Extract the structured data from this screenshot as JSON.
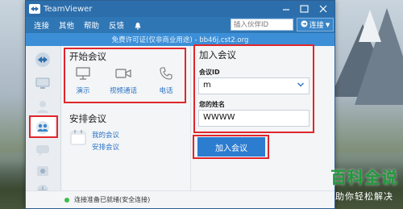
{
  "window": {
    "title": "TeamViewer"
  },
  "menubar": {
    "items": [
      "连接",
      "其他",
      "帮助",
      "反馈"
    ],
    "partner_id_placeholder": "插入伙伴ID",
    "connect_label": "连接"
  },
  "license_notice": "免费许可证(仅非商业用途) - bb46j.cst2.org",
  "start_meeting": {
    "title": "开始会议",
    "actions": [
      "演示",
      "视频通话",
      "电话"
    ]
  },
  "schedule_meeting": {
    "title": "安排会议",
    "links": [
      "我的会议",
      "安排会议"
    ]
  },
  "join_meeting": {
    "title": "加入会议",
    "id_label": "会议ID",
    "id_value": "m",
    "name_label": "您的姓名",
    "name_value": "WWWW",
    "join_button": "加入会议"
  },
  "status": {
    "text": "连接准备已就绪(安全连接)",
    "color": "#3dbb4a"
  },
  "watermark": {
    "main": "百科全说",
    "sub": "助你轻松解决"
  },
  "colors": {
    "accent": "#2c6eab",
    "highlight": "#e0262b",
    "link": "#2d74c4"
  }
}
